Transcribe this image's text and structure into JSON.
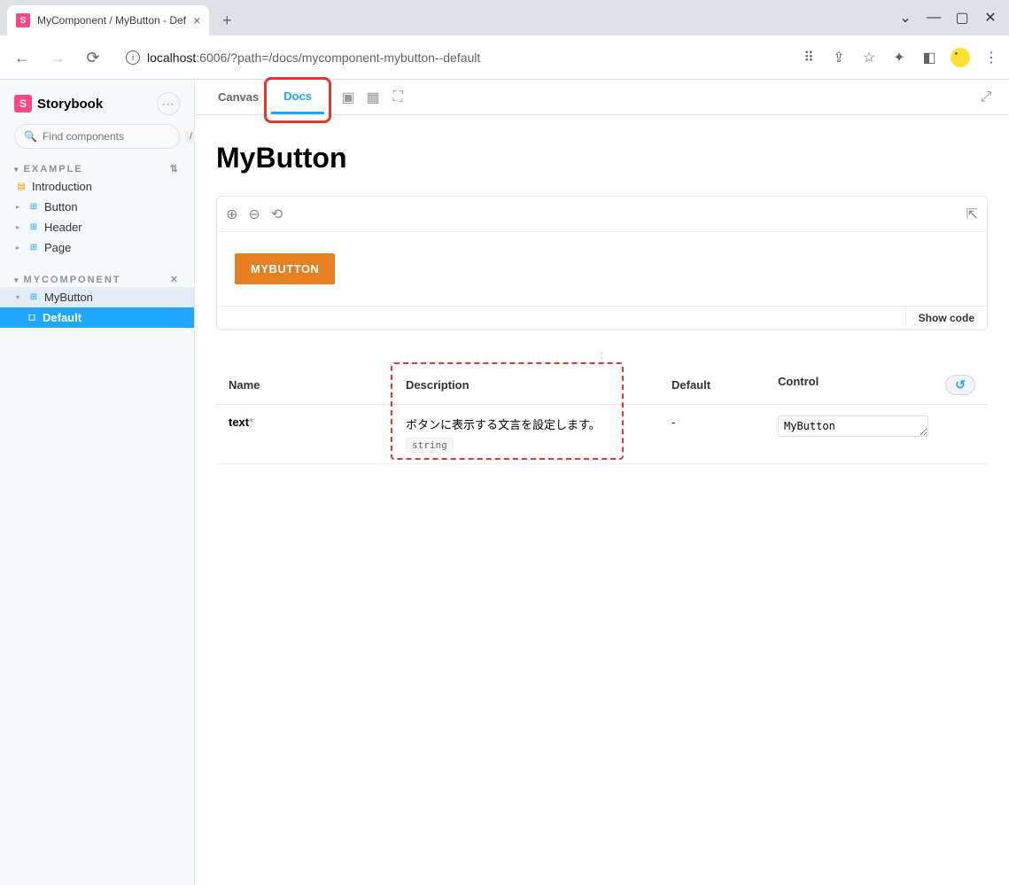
{
  "browser": {
    "tab_title": "MyComponent / MyButton - Def",
    "url_host": "localhost",
    "url_port": ":6006",
    "url_path": "/?path=/docs/mycomponent-mybutton--default"
  },
  "sidebar": {
    "brand": "Storybook",
    "search_placeholder": "Find components",
    "search_shortcut": "/",
    "sections": [
      {
        "title": "EXAMPLE"
      },
      {
        "title": "MYCOMPONENT"
      }
    ],
    "example_items": [
      {
        "label": "Introduction",
        "kind": "doc"
      },
      {
        "label": "Button",
        "kind": "comp"
      },
      {
        "label": "Header",
        "kind": "comp"
      },
      {
        "label": "Page",
        "kind": "comp"
      }
    ],
    "mycomponent_items": [
      {
        "label": "MyButton",
        "kind": "comp"
      },
      {
        "label": "Default",
        "kind": "story"
      }
    ]
  },
  "toolbar": {
    "canvas": "Canvas",
    "docs": "Docs"
  },
  "page": {
    "title": "MyButton",
    "button_label": "MYBUTTON",
    "show_code": "Show code"
  },
  "args": {
    "headers": {
      "name": "Name",
      "description": "Description",
      "default": "Default",
      "control": "Control"
    },
    "rows": [
      {
        "name": "text",
        "required": true,
        "description": "ボタンに表示する文言を設定します。",
        "type": "string",
        "default": "-",
        "control_value": "MyButton"
      }
    ],
    "reset_icon": "↺"
  }
}
